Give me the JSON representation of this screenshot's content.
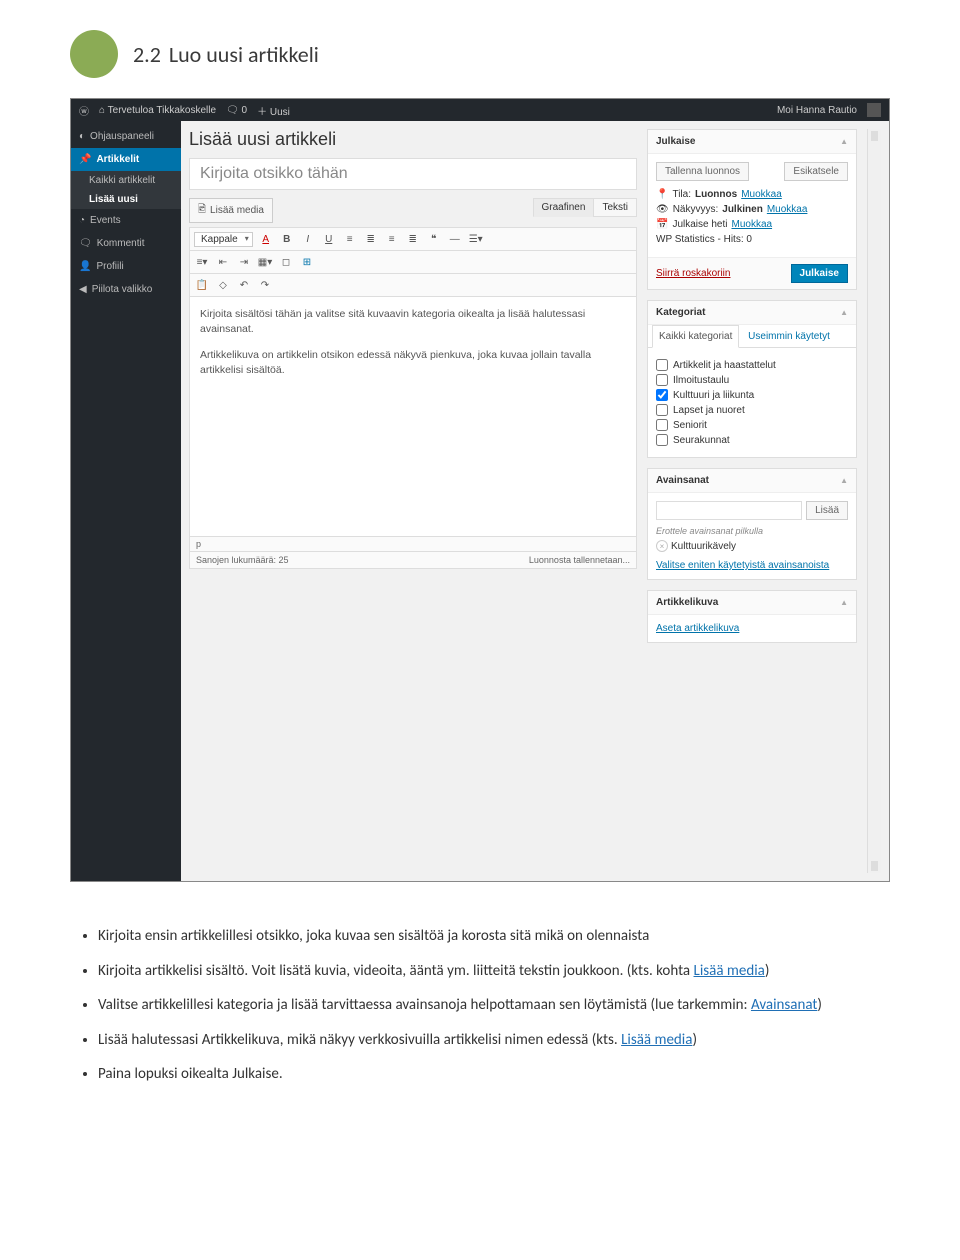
{
  "doc": {
    "section_number": "2.2",
    "section_title": "Luo uusi artikkeli",
    "bullets": {
      "b1": "Kirjoita ensin artikkelillesi otsikko, joka kuvaa sen sisältöä ja korosta sitä mikä on olennaista",
      "b2a": "Kirjoita artikkelisi sisältö. Voit lisätä kuvia, videoita, ääntä ym. liitteitä tekstin joukkoon. (kts. kohta ",
      "b2link": "Lisää media",
      "b2b": ")",
      "b3a": "Valitse artikkelillesi kategoria ja lisää tarvittaessa avainsanoja helpottamaan sen löytämistä (lue tarkemmin: ",
      "b3link": "Avainsanat",
      "b3b": ")",
      "b4a": "Lisää halutessasi Artikkelikuva, mikä näkyy verkkosivuilla artikkelisi nimen edessä (kts. ",
      "b4link": "Lisää media",
      "b4b": ")",
      "b5": "Paina lopuksi oikealta Julkaise."
    }
  },
  "wp": {
    "site_name": "Tervetuloa Tikkakoskelle",
    "comments": "0",
    "new_label": "Uusi",
    "greeting": "Moi Hanna Rautio",
    "menu": {
      "dashboard": "Ohjauspaneeli",
      "posts": "Artikkelit",
      "all_posts": "Kaikki artikkelit",
      "add_new": "Lisää uusi",
      "events": "Events",
      "comments": "Kommentit",
      "profile": "Profiili",
      "collapse": "Piilota valikko"
    },
    "page_title": "Lisää uusi artikkeli",
    "title_placeholder": "Kirjoita otsikko tähän",
    "add_media": "Lisää media",
    "tab_visual": "Graafinen",
    "tab_text": "Teksti",
    "format_select": "Kappale",
    "body_p1": "Kirjoita sisältösi tähän ja valitse sitä kuvaavin kategoria oikealta ja lisää halutessasi avainsanat.",
    "body_p2": "Artikkelikuva on artikkelin otsikon edessä näkyvä pienkuva, joka kuvaa jollain tavalla artikkelisi sisältöä.",
    "path": "p",
    "word_count": "Sanojen lukumäärä: 25",
    "autosave": "Luonnosta tallennetaan...",
    "publish": {
      "heading": "Julkaise",
      "save_draft": "Tallenna luonnos",
      "preview": "Esikatsele",
      "status_label": "Tila:",
      "status_value": "Luonnos",
      "edit": "Muokkaa",
      "visibility_label": "Näkyvyys:",
      "visibility_value": "Julkinen",
      "schedule_label": "Julkaise heti",
      "stats": "WP Statistics - Hits: 0",
      "trash": "Siirrä roskakoriin",
      "publish_btn": "Julkaise"
    },
    "cats": {
      "heading": "Kategoriat",
      "tab_all": "Kaikki kategoriat",
      "tab_most": "Useimmin käytetyt",
      "c1": "Artikkelit ja haastattelut",
      "c2": "Ilmoitustaulu",
      "c3": "Kulttuuri ja liikunta",
      "c4": "Lapset ja nuoret",
      "c5": "Seniorit",
      "c6": "Seurakunnat"
    },
    "tags": {
      "heading": "Avainsanat",
      "add": "Lisää",
      "hint": "Erottele avainsanat pilkulla",
      "chip": "Kulttuurikävely",
      "choose": "Valitse eniten käytetyistä avainsanoista"
    },
    "thumb": {
      "heading": "Artikkelikuva",
      "set": "Aseta artikkelikuva"
    }
  }
}
